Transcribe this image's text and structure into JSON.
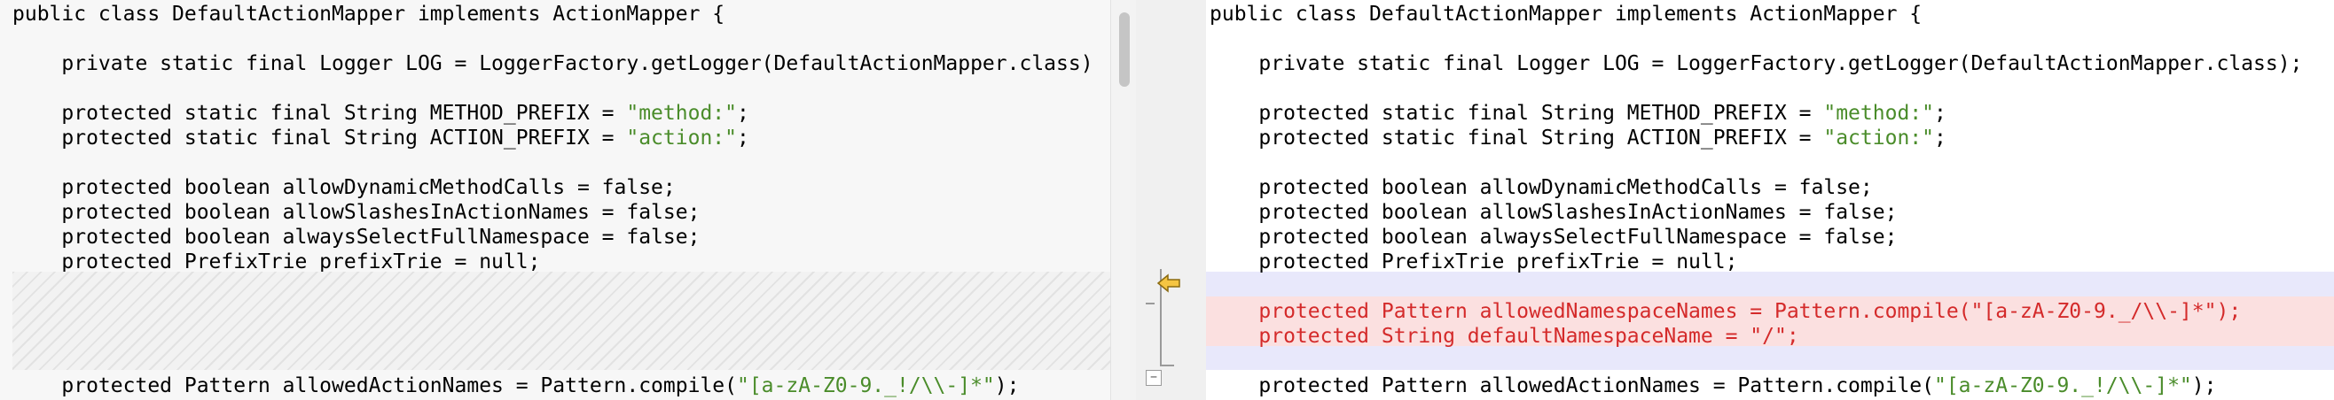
{
  "left": {
    "lines": [
      [
        {
          "t": "public class DefaultActionMapper implements ActionMapper {"
        }
      ],
      [
        {
          "t": ""
        }
      ],
      [
        {
          "t": "    private static final Logger LOG = LoggerFactory.getLogger(DefaultActionMapper.class)"
        }
      ],
      [
        {
          "t": ""
        }
      ],
      [
        {
          "t": "    protected static final String METHOD_PREFIX = "
        },
        {
          "t": "\"method:\"",
          "c": "str"
        },
        {
          "t": ";"
        }
      ],
      [
        {
          "t": "    protected static final String ACTION_PREFIX = "
        },
        {
          "t": "\"action:\"",
          "c": "str"
        },
        {
          "t": ";"
        }
      ],
      [
        {
          "t": ""
        }
      ],
      [
        {
          "t": "    protected boolean allowDynamicMethodCalls = false;"
        }
      ],
      [
        {
          "t": "    protected boolean allowSlashesInActionNames = false;"
        }
      ],
      [
        {
          "t": "    protected boolean alwaysSelectFullNamespace = false;"
        }
      ],
      [
        {
          "t": "    protected PrefixTrie prefixTrie = null;"
        }
      ]
    ],
    "after_gap": [
      [
        {
          "t": "    protected Pattern allowedActionNames = Pattern.compile("
        },
        {
          "t": "\"[a-zA-Z0-9._!/\\\\-]*\"",
          "c": "str"
        },
        {
          "t": ");"
        }
      ]
    ]
  },
  "right": {
    "lines": [
      [
        {
          "t": "public class DefaultActionMapper implements ActionMapper {"
        }
      ],
      [
        {
          "t": ""
        }
      ],
      [
        {
          "t": "    private static final Logger LOG = LoggerFactory.getLogger(DefaultActionMapper.class);"
        }
      ],
      [
        {
          "t": ""
        }
      ],
      [
        {
          "t": "    protected static final String METHOD_PREFIX = "
        },
        {
          "t": "\"method:\"",
          "c": "str"
        },
        {
          "t": ";"
        }
      ],
      [
        {
          "t": "    protected static final String ACTION_PREFIX = "
        },
        {
          "t": "\"action:\"",
          "c": "str"
        },
        {
          "t": ";"
        }
      ],
      [
        {
          "t": ""
        }
      ],
      [
        {
          "t": "    protected boolean allowDynamicMethodCalls = false;"
        }
      ],
      [
        {
          "t": "    protected boolean allowSlashesInActionNames = false;"
        }
      ],
      [
        {
          "t": "    protected boolean alwaysSelectFullNamespace = false;"
        }
      ],
      [
        {
          "t": "    protected PrefixTrie prefixTrie = null;"
        }
      ]
    ],
    "changed": [
      [
        {
          "t": "    protected Pattern allowedNamespaceNames = Pattern.compile(\"[a-zA-Z0-9._/\\\\-]*\");"
        }
      ],
      [
        {
          "t": "    protected String defaultNamespaceName = \"/\";"
        }
      ]
    ],
    "after_gap": [
      [
        {
          "t": "    protected Pattern allowedActionNames = Pattern.compile("
        },
        {
          "t": "\"[a-zA-Z0-9._!/\\\\-]*\"",
          "c": "str"
        },
        {
          "t": ");"
        }
      ]
    ]
  },
  "colors": {
    "string": "#4a8c2a",
    "changed_text": "#d42a2a",
    "changed_bg": "#fbe0e0",
    "context_bg": "#e8e8fb",
    "arrow_fill": "#f5c542"
  },
  "icons": {
    "arrow": "merge-left-arrow-icon",
    "collapse": "collapse-minus-icon",
    "collapse_glyph": "−"
  }
}
